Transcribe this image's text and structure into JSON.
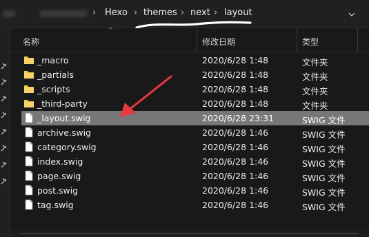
{
  "address_bar": {
    "crumbs": [
      "Hexo",
      "themes",
      "next",
      "layout"
    ],
    "dropdown_icon": "chevron-down-icon"
  },
  "columns": {
    "name": "名称",
    "modified": "修改日期",
    "type": "类型"
  },
  "files": [
    {
      "name": "_macro",
      "date": "2020/6/28 1:48",
      "type": "文件夹",
      "icon": "folder-icon",
      "selected": false
    },
    {
      "name": "_partials",
      "date": "2020/6/28 1:48",
      "type": "文件夹",
      "icon": "folder-icon",
      "selected": false
    },
    {
      "name": "_scripts",
      "date": "2020/6/28 1:48",
      "type": "文件夹",
      "icon": "folder-icon",
      "selected": false
    },
    {
      "name": "_third-party",
      "date": "2020/6/28 1:48",
      "type": "文件夹",
      "icon": "folder-icon",
      "selected": false
    },
    {
      "name": "_layout.swig",
      "date": "2020/6/28 23:31",
      "type": "SWIG 文件",
      "icon": "file-icon",
      "selected": true
    },
    {
      "name": "archive.swig",
      "date": "2020/6/28 1:46",
      "type": "SWIG 文件",
      "icon": "file-icon",
      "selected": false
    },
    {
      "name": "category.swig",
      "date": "2020/6/28 1:46",
      "type": "SWIG 文件",
      "icon": "file-icon",
      "selected": false
    },
    {
      "name": "index.swig",
      "date": "2020/6/28 1:46",
      "type": "SWIG 文件",
      "icon": "file-icon",
      "selected": false
    },
    {
      "name": "page.swig",
      "date": "2020/6/28 1:46",
      "type": "SWIG 文件",
      "icon": "file-icon",
      "selected": false
    },
    {
      "name": "post.swig",
      "date": "2020/6/28 1:46",
      "type": "SWIG 文件",
      "icon": "file-icon",
      "selected": false
    },
    {
      "name": "tag.swig",
      "date": "2020/6/28 1:46",
      "type": "SWIG 文件",
      "icon": "file-icon",
      "selected": false
    }
  ],
  "colors": {
    "folder": "#f3c849",
    "selected_row": "#777777",
    "annotation": "#e8393f"
  }
}
